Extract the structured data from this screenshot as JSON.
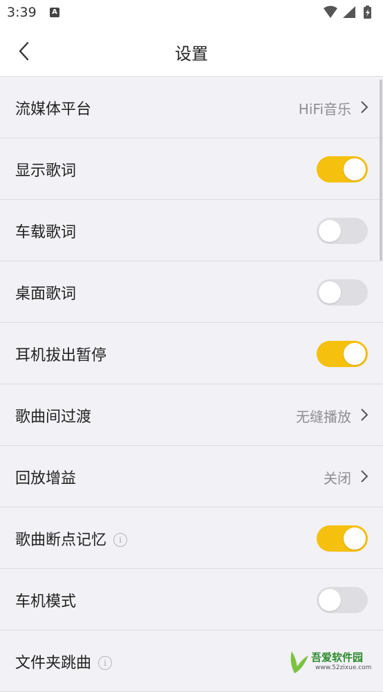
{
  "status_bar": {
    "time": "3:39",
    "notification_icon": "A"
  },
  "header": {
    "title": "设置"
  },
  "settings": [
    {
      "label": "流媒体平台",
      "value": "HiFi音乐"
    },
    {
      "label": "显示歌词",
      "toggle": true
    },
    {
      "label": "车载歌词",
      "toggle": false
    },
    {
      "label": "桌面歌词",
      "toggle": false
    },
    {
      "label": "耳机拔出暂停",
      "toggle": true
    },
    {
      "label": "歌曲间过渡",
      "value": "无缝播放"
    },
    {
      "label": "回放增益",
      "value": "关闭"
    },
    {
      "label": "歌曲断点记忆",
      "info": "i",
      "toggle": true
    },
    {
      "label": "车机模式",
      "toggle": false
    },
    {
      "label": "文件夹跳曲",
      "info": "i"
    }
  ],
  "watermark": {
    "name": "吾爱软件园",
    "url": "www.52zixue.com"
  },
  "colors": {
    "accent": "#f5c00e",
    "toggle_off": "#dddde2",
    "background": "#f2f1f6"
  }
}
